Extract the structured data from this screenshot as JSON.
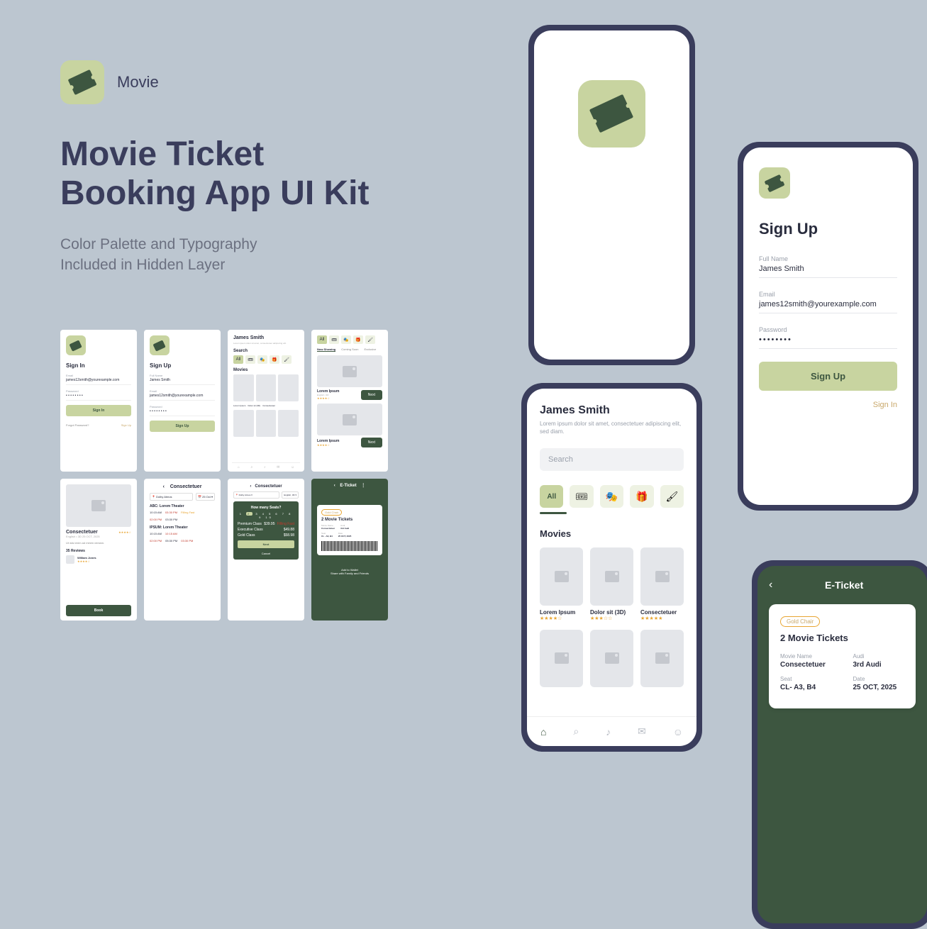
{
  "brand": {
    "name": "Movie"
  },
  "headline": {
    "line1": "Movie Ticket",
    "line2": "Booking App UI Kit"
  },
  "subhead": {
    "line1": "Color Palette and Typography",
    "line2": "Included in Hidden Layer"
  },
  "signup": {
    "title": "Sign Up",
    "full_name_label": "Full Name",
    "full_name": "James Smith",
    "email_label": "Email",
    "email": "james12smith@yourexample.com",
    "password_label": "Password",
    "password": "••••••••",
    "button": "Sign Up",
    "signin_link": "Sign In"
  },
  "home": {
    "user": "James Smith",
    "sub": "Lorem ipsum dolor sit amet, consectetuer adipiscing elit, sed diam.",
    "search": "Search",
    "all": "All",
    "movies_title": "Movies",
    "movies": [
      {
        "title": "Lorem Ipsum",
        "stars": "★★★★☆"
      },
      {
        "title": "Dolor sit (3D)",
        "stars": "★★★☆☆"
      },
      {
        "title": "Consectetuer",
        "stars": "★★★★★"
      }
    ],
    "nav": [
      "⌂",
      "⌕",
      "♪",
      "✉",
      "☺"
    ]
  },
  "eticket": {
    "title": "E-Ticket",
    "badge": "Gold Chair",
    "count": "2 Movie Tickets",
    "movie_label": "Movie Name",
    "movie": "Consectetuer",
    "audi_label": "Audi",
    "audi": "3rd Audi",
    "seat_label": "Seat",
    "seat": "CL- A3, B4",
    "date_label": "Date",
    "date": "25 OCT, 2025"
  },
  "thumbs": {
    "signin": {
      "title": "Sign In",
      "email_label": "Email",
      "email": "james12smith@yourexample.com",
      "pw_label": "Password",
      "btn": "Sign In",
      "forgot": "Forgot Password?",
      "alt": "Sign Up"
    },
    "signup": {
      "title": "Sign Up",
      "name_label": "Full Name",
      "name": "James Smith",
      "email_label": "Email",
      "email": "james12smith@yourexample.com",
      "pw_label": "Password",
      "btn": "Sign Up"
    },
    "home": {
      "user": "James Smith",
      "search": "Search",
      "movies": "Movies"
    },
    "listing": {
      "tabs": [
        "Now Showing",
        "Coming Soon",
        "Exclusive"
      ],
      "name": "Lorem Ipsum",
      "eng": "English • 3D",
      "next": "Next",
      "lorem": "Lorem Ipsum"
    },
    "detail": {
      "title": "Consectetuer",
      "eng": "English • 3D   25 OCT, 2025",
      "desc": "Ut wisi enim ad minim veniam.",
      "reviews": "35 Reviews",
      "reviewer": "William Jones",
      "book": "Book"
    },
    "showtimes": {
      "title": "Consectetuer",
      "loc": "Dolby Atmos",
      "date": "25 Oct ▾",
      "th1": "ABC: Lorem Theater",
      "th2": "IPSUM: Lorem Theater",
      "t1": "10:15 AM",
      "t2": "03:30 PM",
      "t3": "02:00 PM",
      "t4": "10:15 AM",
      "t5": "02:00 PM",
      "t6": "05:30 PM",
      "filling": "Filling Fast"
    },
    "seats": {
      "title": "Consectetuer",
      "q": "How many Seats?",
      "prem_l": "Premium Class",
      "prem": "$39.95",
      "exec_l": "Executive Class",
      "exec": "$49.88",
      "gold_l": "Gold Class",
      "gold": "$58.98",
      "next": "Next",
      "cancel": "Cancel"
    },
    "eticket": {
      "title": "E-Ticket",
      "count": "2 Movie Tickets",
      "movie": "Consectetuer",
      "audi": "3rd Audi",
      "seat": "CL - A3, B4",
      "date": "25 OCT, 2025",
      "wallet": "Add to Wallet",
      "share": "Share with Family and Friends"
    }
  }
}
